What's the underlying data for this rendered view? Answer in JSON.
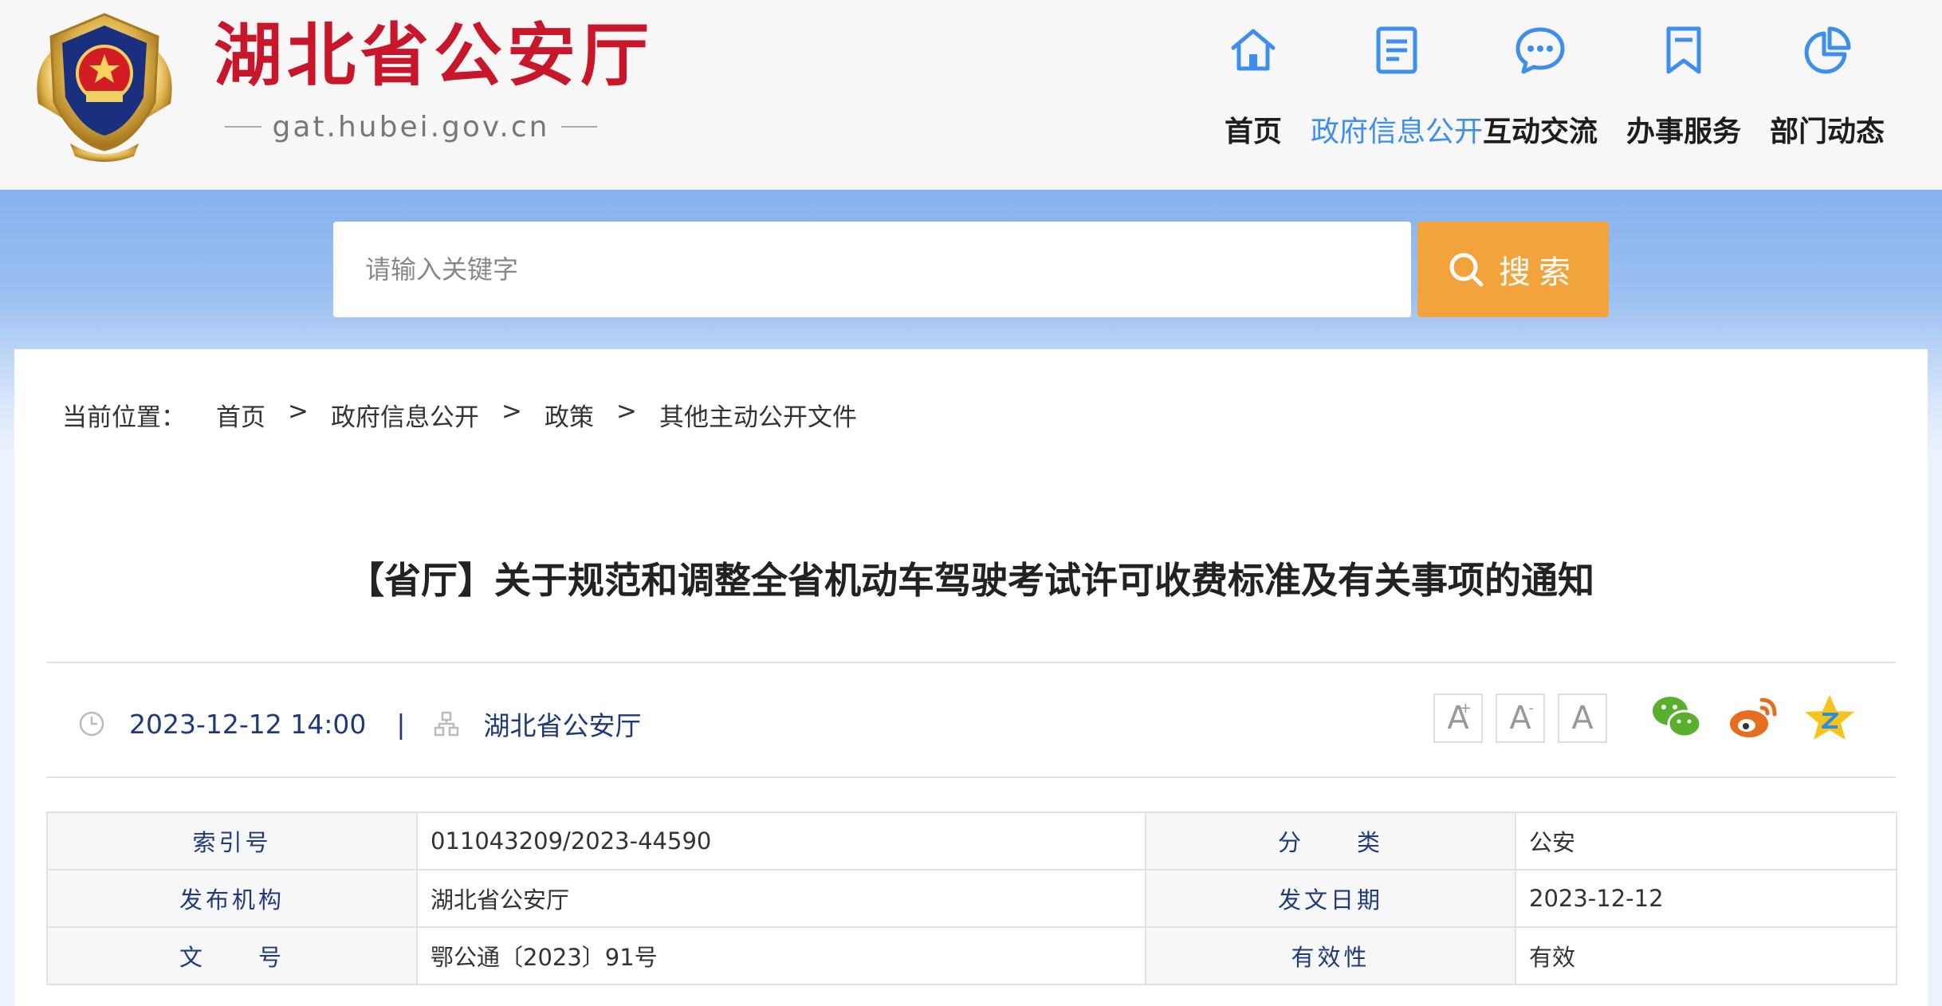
{
  "header": {
    "site_title": "湖北省公安厅",
    "site_domain": "gat.hubei.gov.cn",
    "nav": [
      {
        "label": "首页",
        "icon": "home-icon"
      },
      {
        "label": "政府信息公开",
        "icon": "document-icon",
        "active": true
      },
      {
        "label": "互动交流",
        "icon": "chat-bubble-icon"
      },
      {
        "label": "办事服务",
        "icon": "bookmark-icon"
      },
      {
        "label": "部门动态",
        "icon": "pie-chart-icon"
      }
    ]
  },
  "search": {
    "placeholder": "请输入关键字",
    "button_label": "搜索"
  },
  "breadcrumb": {
    "prefix": "当前位置：",
    "items": [
      "首页",
      "政府信息公开",
      "政策",
      "其他主动公开文件"
    ],
    "separator": ">"
  },
  "article": {
    "title": "【省厅】关于规范和调整全省机动车驾驶考试许可收费标准及有关事项的通知",
    "datetime": "2023-12-12 14:00",
    "separator": "|",
    "source": "湖北省公安厅"
  },
  "font_size": {
    "increase": "A",
    "increase_mark": "+",
    "decrease": "A",
    "decrease_mark": "-",
    "reset": "A"
  },
  "share": [
    "wechat-icon",
    "weibo-icon",
    "qzone-icon"
  ],
  "info_table": {
    "index_label": "索引号",
    "index_value": "011043209/2023-44590",
    "category_label": "分　　类",
    "category_value": "公安",
    "publisher_label": "发布机构",
    "publisher_value": "湖北省公安厅",
    "date_label": "发文日期",
    "date_value": "2023-12-12",
    "doc_no_label": "文　　号",
    "doc_no_value": "鄂公通〔2023〕91号",
    "validity_label": "有效性",
    "validity_value": "有效"
  },
  "colors": {
    "brand_red": "#c8162b",
    "nav_active": "#3d8eee",
    "search_button": "#f2a33c",
    "meta_text": "#1f3a7a"
  }
}
